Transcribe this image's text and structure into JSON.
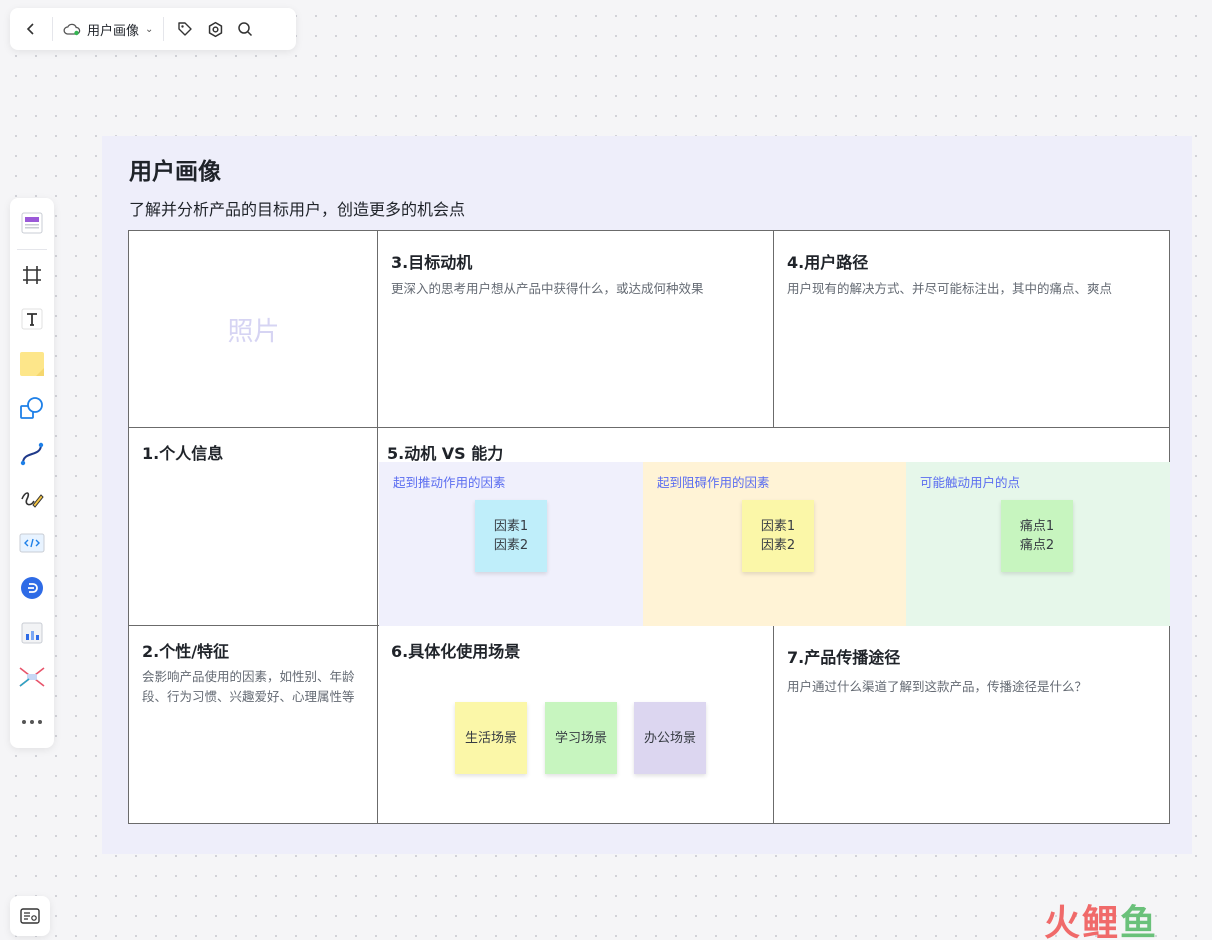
{
  "topbar": {
    "doc_title": "用户画像"
  },
  "board": {
    "title": "用户画像",
    "subtitle": "了解并分析产品的目标用户，创造更多的机会点",
    "photo_label": "照片",
    "sections": {
      "motivation": {
        "title": "3.目标动机",
        "desc": "更深入的思考用户想从产品中获得什么，或达成何种效果"
      },
      "path": {
        "title": "4.用户路径",
        "desc": "用户现有的解决方式、并尽可能标注出，其中的痛点、爽点"
      },
      "personal": {
        "title": "1.个人信息"
      },
      "vs": {
        "title": "5.动机 VS 能力"
      },
      "traits": {
        "title": "2.个性/特征",
        "desc": "会影响产品使用的因素，如性别、年龄段、行为习惯、兴趣爱好、心理属性等"
      },
      "scenes": {
        "title": "6.具体化使用场景"
      },
      "spread": {
        "title": "7.产品传播途径",
        "desc": "用户通过什么渠道了解到这款产品，传播途径是什么？"
      }
    },
    "columns": [
      {
        "label": "起到推动作用的因素",
        "notes": [
          "因素1",
          "因素2"
        ]
      },
      {
        "label": "起到阻碍作用的因素",
        "notes": [
          "因素1",
          "因素2"
        ]
      },
      {
        "label": "可能触动用户的点",
        "notes": [
          "痛点1",
          "痛点2"
        ]
      }
    ],
    "scene_notes": [
      "生活场景",
      "学习场景",
      "办公场景"
    ]
  },
  "watermark": {
    "c1": "火",
    "c2": "鲤",
    "c3": "鱼"
  },
  "colors": {
    "board_bg": "#eeeefa",
    "col_push": "#f0f0fc",
    "col_block": "#fff3d6",
    "col_touch": "#e6f7ea",
    "note_blue": "#bfeefa",
    "note_yellow": "#fbf7a8",
    "note_green": "#c7f5bf",
    "note_purple": "#dcd6f0",
    "label_blue": "#5b6df0"
  }
}
